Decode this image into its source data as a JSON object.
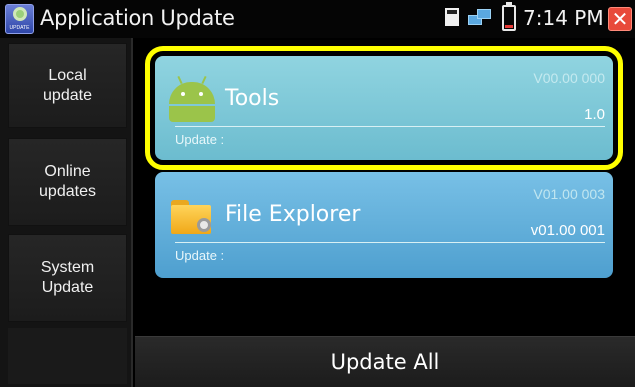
{
  "titlebar": {
    "app_icon_tag": "UPDATE",
    "title": "Application Update",
    "time": "7:14 PM",
    "close_glyph": "✕"
  },
  "sidebar": {
    "items": [
      {
        "label": "Local\nupdate"
      },
      {
        "label": "Online\nupdates"
      },
      {
        "label": "System\nUpdate"
      }
    ]
  },
  "apps": [
    {
      "name": "Tools",
      "version_available": "V00.00 000",
      "version_current": "1.0",
      "update_label": "Update :",
      "icon": "android-icon",
      "selected": true
    },
    {
      "name": "File Explorer",
      "version_available": "V01.00 003",
      "version_current": "v01.00 001",
      "update_label": "Update :",
      "icon": "folder-gear-icon",
      "selected": false
    }
  ],
  "footer": {
    "update_all_label": "Update All"
  },
  "colors": {
    "selection_outline": "#ffff00",
    "card_tools": "#7cc8d8",
    "card_file_explorer": "#60acd8",
    "close_button": "#e84a3a"
  }
}
